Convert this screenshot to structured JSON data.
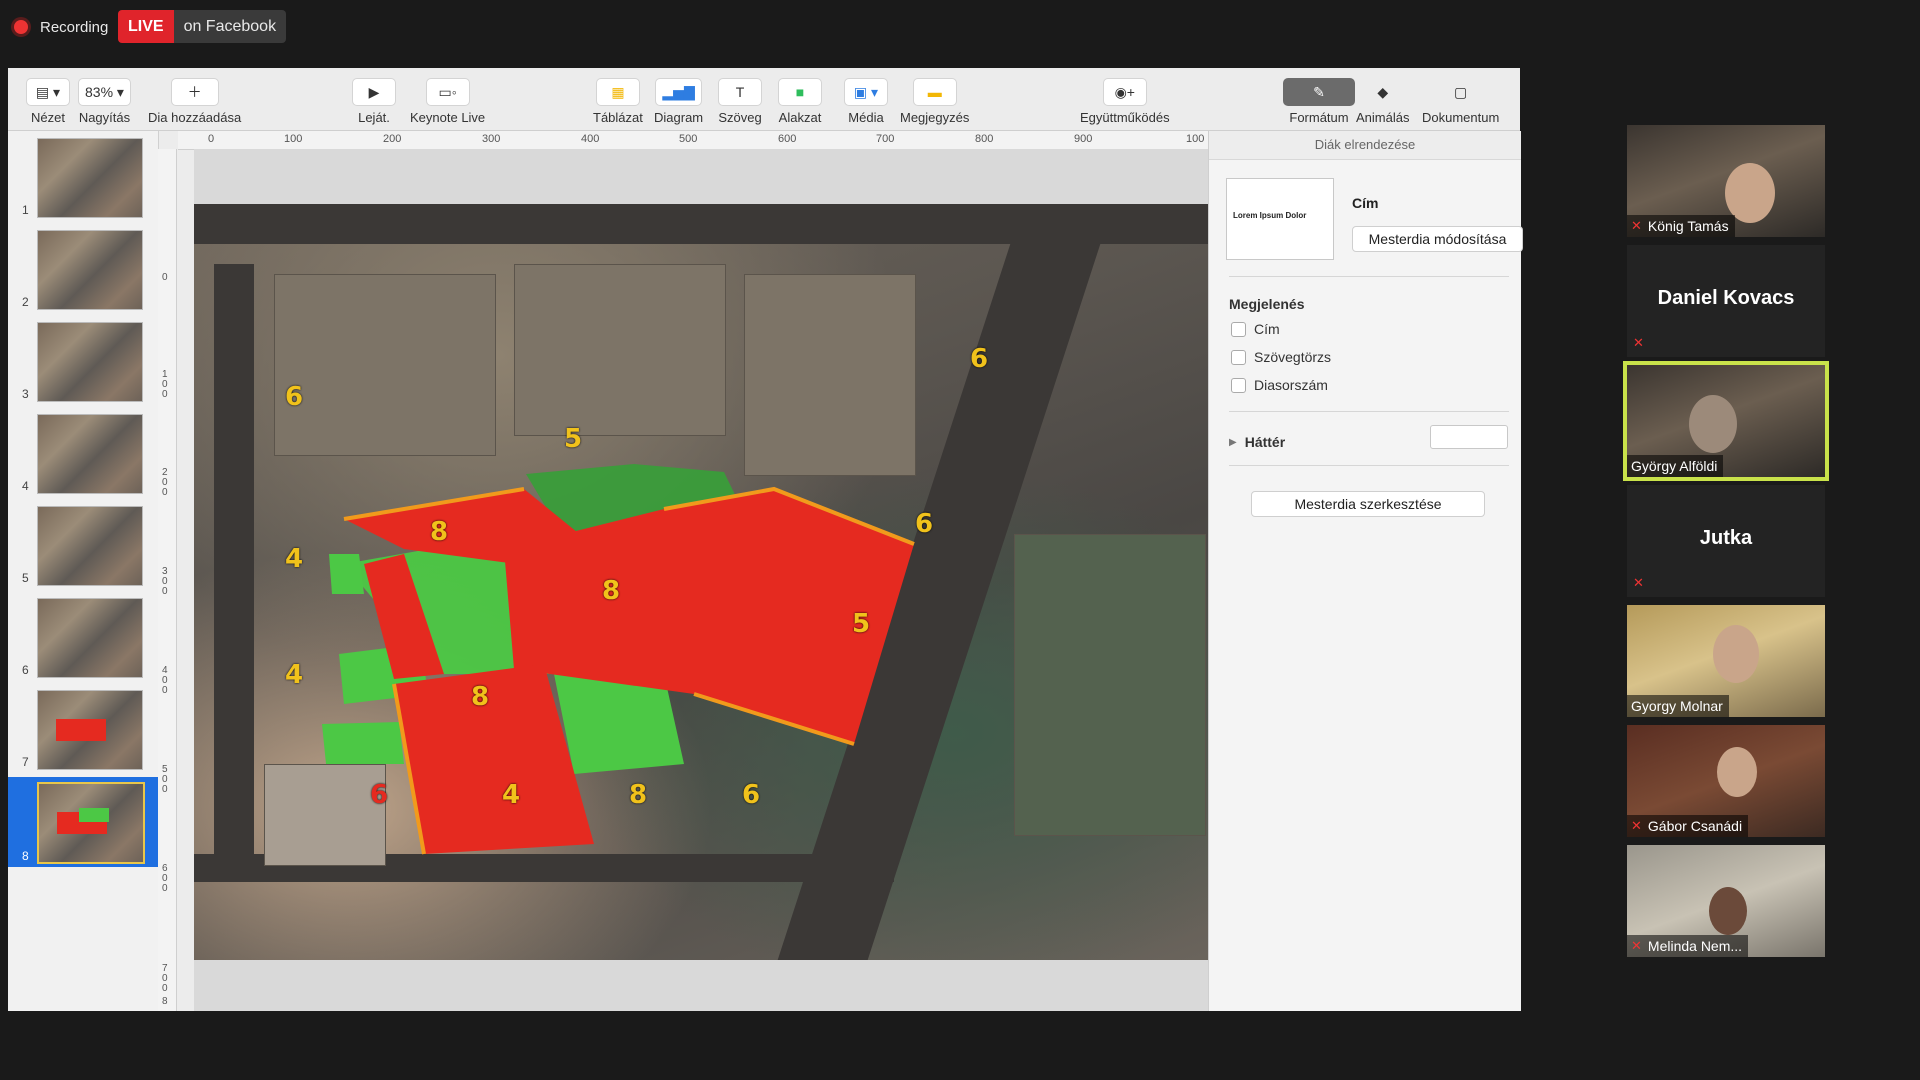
{
  "recording": {
    "label": "Recording"
  },
  "live": {
    "badge": "LIVE",
    "text": "on Facebook"
  },
  "toolbar": {
    "view_label": "Nézet",
    "zoom_value": "83%",
    "zoom_label": "Nagyítás",
    "add_slide_label": "Dia hozzáadása",
    "play_label": "Leját.",
    "keynote_live_label": "Keynote Live",
    "table_label": "Táblázat",
    "chart_label": "Diagram",
    "text_label": "Szöveg",
    "shape_label": "Alakzat",
    "media_label": "Média",
    "comment_label": "Megjegyzés",
    "collab_label": "Együttműködés",
    "format_label": "Formátum",
    "animate_label": "Animálás",
    "document_label": "Dokumentum"
  },
  "thumbnails": [
    "1",
    "2",
    "3",
    "4",
    "5",
    "6",
    "7",
    "8"
  ],
  "selected_slide": "8",
  "ruler_top": [
    "0",
    "100",
    "200",
    "300",
    "400",
    "500",
    "600",
    "700",
    "800",
    "900",
    "100"
  ],
  "ruler_left": [
    "0",
    "100",
    "200",
    "300",
    "400",
    "500",
    "600",
    "700",
    "8"
  ],
  "slide_labels": {
    "n1": "6",
    "n2": "5",
    "n3": "6",
    "n4": "6",
    "n5": "8",
    "n6": "4",
    "n7": "8",
    "n8": "5",
    "n9": "4",
    "n10": "8",
    "n11": "6",
    "n12": "4",
    "n13": "8",
    "n14": "6"
  },
  "panel": {
    "header": "Diák elrendezése",
    "master_thumb_title": "Lorem Ipsum Dolor",
    "master_title": "Cím",
    "master_change_button": "Mesterdia módosítása",
    "appearance_heading": "Megjelenés",
    "chk_title": "Cím",
    "chk_body": "Szövegtörzs",
    "chk_slide_number": "Diasorszám",
    "background_label": "Háttér",
    "edit_master_button": "Mesterdia szerkesztése"
  },
  "participants": [
    {
      "name": "König Tamás",
      "muted": true
    },
    {
      "name": "Daniel Kovacs",
      "muted": true
    },
    {
      "name": "György Alföldi",
      "muted": false,
      "active": true
    },
    {
      "name": "Jutka",
      "muted": true
    },
    {
      "name": "Gyorgy Molnar",
      "muted": false
    },
    {
      "name": "Gábor Csanádi",
      "muted": true
    },
    {
      "name": "Melinda Nem...",
      "muted": true
    }
  ],
  "colors": {
    "highlight": "#c9e24a",
    "red_area": "#e52a20",
    "green_area": "#4cc845",
    "number": "#f1c21b",
    "live": "#e0242b",
    "selection": "#1f6fe0"
  }
}
